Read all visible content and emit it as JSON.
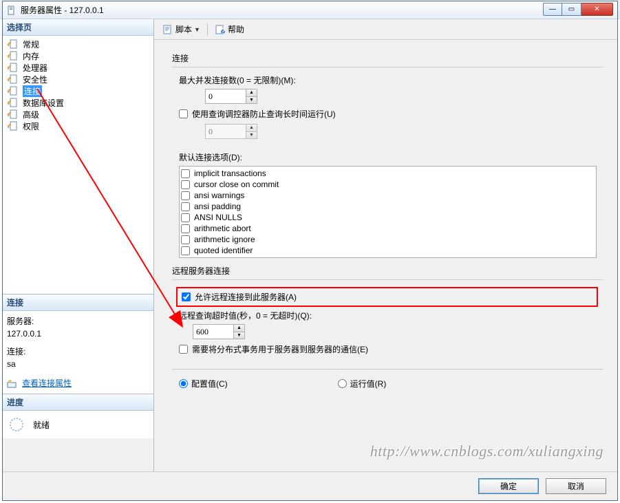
{
  "window": {
    "title": "服务器属性 - 127.0.0.1"
  },
  "winbuttons": {
    "min": "—",
    "max": "▭",
    "close": "✕"
  },
  "left": {
    "select_page": "选择页",
    "items": [
      {
        "label": "常规"
      },
      {
        "label": "内存"
      },
      {
        "label": "处理器"
      },
      {
        "label": "安全性"
      },
      {
        "label": "连接",
        "selected": true
      },
      {
        "label": "数据库设置"
      },
      {
        "label": "高级"
      },
      {
        "label": "权限"
      }
    ],
    "conn_title": "连接",
    "server_label": "服务器:",
    "server_value": "127.0.0.1",
    "conn_label": "连接:",
    "conn_value": "sa",
    "view_props_link": "查看连接属性",
    "progress_title": "进度",
    "ready": "就绪"
  },
  "toolbar": {
    "script": "脚本",
    "help": "帮助"
  },
  "content": {
    "group_conn": "连接",
    "max_concurrent_label": "最大并发连接数(0 = 无限制)(M):",
    "max_concurrent_value": "0",
    "use_query_governor_label": "使用查询调控器防止查询长时间运行(U)",
    "governor_value": "0",
    "default_opts_label": "默认连接选项(D):",
    "options": [
      "implicit transactions",
      "cursor close on commit",
      "ansi warnings",
      "ansi padding",
      "ANSI NULLS",
      "arithmetic abort",
      "arithmetic ignore",
      "quoted identifier"
    ],
    "group_remote": "远程服务器连接",
    "allow_remote_label": "允许远程连接到此服务器(A)",
    "remote_timeout_label": "远程查询超时值(秒，0 = 无超时)(Q):",
    "remote_timeout_value": "600",
    "require_dtc_label": "需要将分布式事务用于服务器到服务器的通信(E)",
    "radio_config": "配置值(C)",
    "radio_run": "运行值(R)"
  },
  "footer": {
    "ok": "确定",
    "cancel": "取消"
  },
  "watermark": "http://www.cnblogs.com/xuliangxing"
}
